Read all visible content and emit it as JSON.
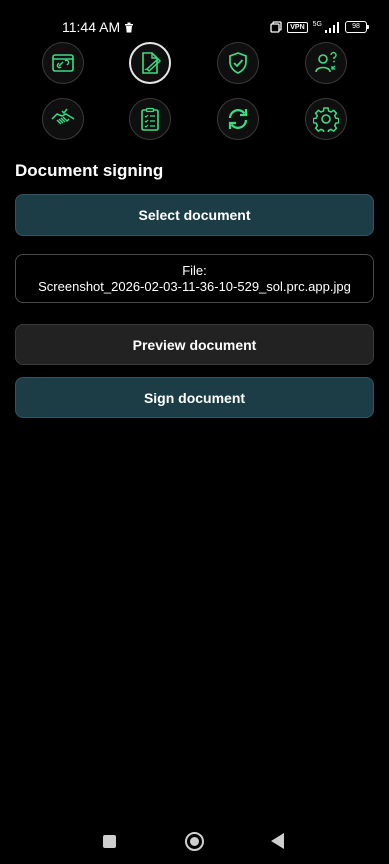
{
  "status_bar": {
    "time": "11:44 AM",
    "vpn": "VPN",
    "network": "5G",
    "battery": "98"
  },
  "icons": [
    {
      "name": "wallet-link-icon"
    },
    {
      "name": "document-sign-icon",
      "active": true
    },
    {
      "name": "shield-check-icon"
    },
    {
      "name": "user-help-icon"
    },
    {
      "name": "handshake-icon"
    },
    {
      "name": "clipboard-checklist-icon"
    },
    {
      "name": "sync-icon"
    },
    {
      "name": "settings-gear-icon"
    }
  ],
  "accent_color": "#3ddc84",
  "main": {
    "title": "Document signing",
    "select_button": "Select document",
    "file_label": "File:",
    "file_name": "Screenshot_2026-02-03-11-36-10-529_sol.prc.app.jpg",
    "preview_button": "Preview document",
    "sign_button": "Sign document"
  }
}
